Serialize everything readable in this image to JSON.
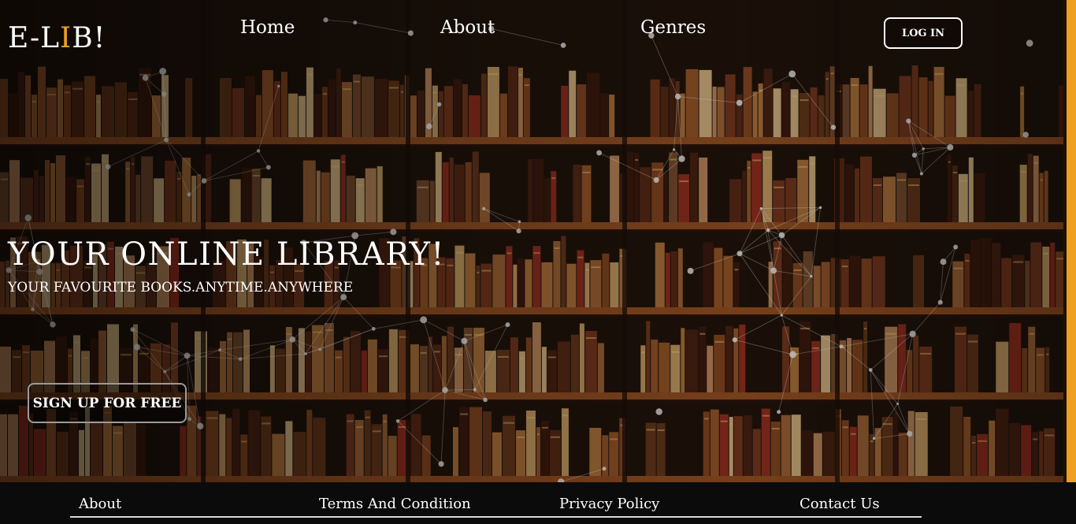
{
  "header": {
    "logo_prefix": "E-L",
    "logo_accent": "I",
    "logo_suffix": "B!",
    "nav": [
      {
        "label": "Home"
      },
      {
        "label": "About"
      },
      {
        "label": "Genres"
      }
    ],
    "login_label": "LOG IN"
  },
  "hero": {
    "title": "YOUR ONLINE LIBRARY!",
    "subtitle": "YOUR FAVOURITE BOOKS.ANYTIME.ANYWHERE",
    "signup_label": "SIGN UP FOR FREE"
  },
  "footer": {
    "links": [
      {
        "label": "About"
      },
      {
        "label": "Terms And Condition"
      },
      {
        "label": "Privacy Policy"
      },
      {
        "label": "Contact Us"
      }
    ]
  },
  "colors": {
    "accent": "#f0a020",
    "text": "#ffffff",
    "footer_bg": "#0b0b0b"
  }
}
